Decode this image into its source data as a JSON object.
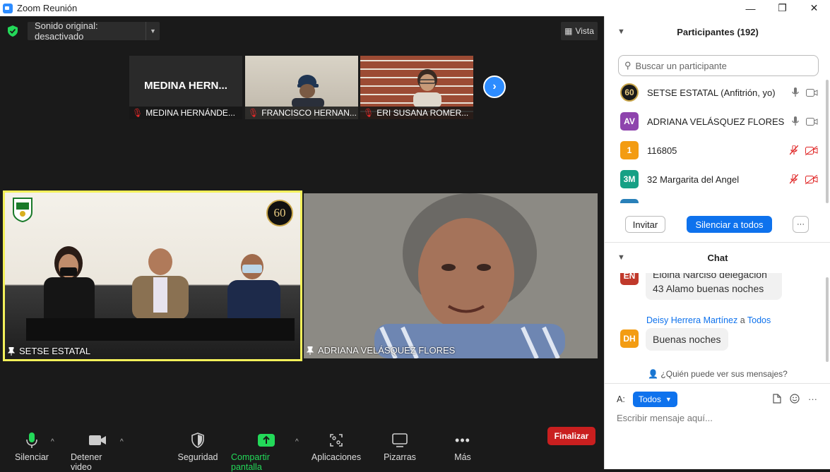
{
  "window": {
    "title": "Zoom Reunión",
    "controls": [
      "—",
      "❐",
      "✕"
    ]
  },
  "top_bar": {
    "audio_label": "Sonido original: desactivado",
    "view_label": "Vista"
  },
  "thumbnails": [
    {
      "display_name": "MEDINA  HERN...",
      "name": "MEDINA HERNÁNDE..."
    },
    {
      "name": "FRANCISCO HERNAN..."
    },
    {
      "name": "ERI SUSANA ROMER..."
    }
  ],
  "main_tiles": [
    {
      "name": "SETSE ESTATAL",
      "badge": "60"
    },
    {
      "name": "ADRIANA VELÁSQUEZ FLORES"
    }
  ],
  "toolbar": {
    "mute": "Silenciar",
    "video": "Detener video",
    "security": "Seguridad",
    "share": "Compartir pantalla",
    "apps": "Aplicaciones",
    "whiteboards": "Pizarras",
    "more": "Más",
    "end": "Finalizar"
  },
  "participants": {
    "title": "Participantes (192)",
    "search_placeholder": "Buscar un participante",
    "list": [
      {
        "initials": "60",
        "name": "SETSE ESTATAL (Anfitrión, yo)",
        "color": "#1a1a1a",
        "muted": false
      },
      {
        "initials": "AV",
        "name": "ADRIANA VELÁSQUEZ FLORES",
        "color": "#8e44ad",
        "muted": false
      },
      {
        "initials": "1",
        "name": "116805",
        "color": "#f39c12",
        "muted": true
      },
      {
        "initials": "3M",
        "name": "32 Margarita del Angel",
        "color": "#16a085",
        "muted": true
      }
    ],
    "invite": "Invitar",
    "mute_all": "Silenciar a todos",
    "more": "···"
  },
  "chat": {
    "title": "Chat",
    "messages": [
      {
        "initials": "EN",
        "color": "#c0392b",
        "text_line1": "Eloina Narciso delegación",
        "text_line2": "43 Alamo buenas noches"
      },
      {
        "sender": "Deisy Herrera Martínez",
        "connector": "a",
        "recipient": "Todos",
        "initials": "DH",
        "color": "#f39c12",
        "text": "Buenas noches"
      }
    ],
    "who_can_see": "¿Quién puede ver sus mensajes?",
    "to_label": "A:",
    "to_value": "Todos",
    "placeholder": "Escribir mensaje aquí..."
  }
}
